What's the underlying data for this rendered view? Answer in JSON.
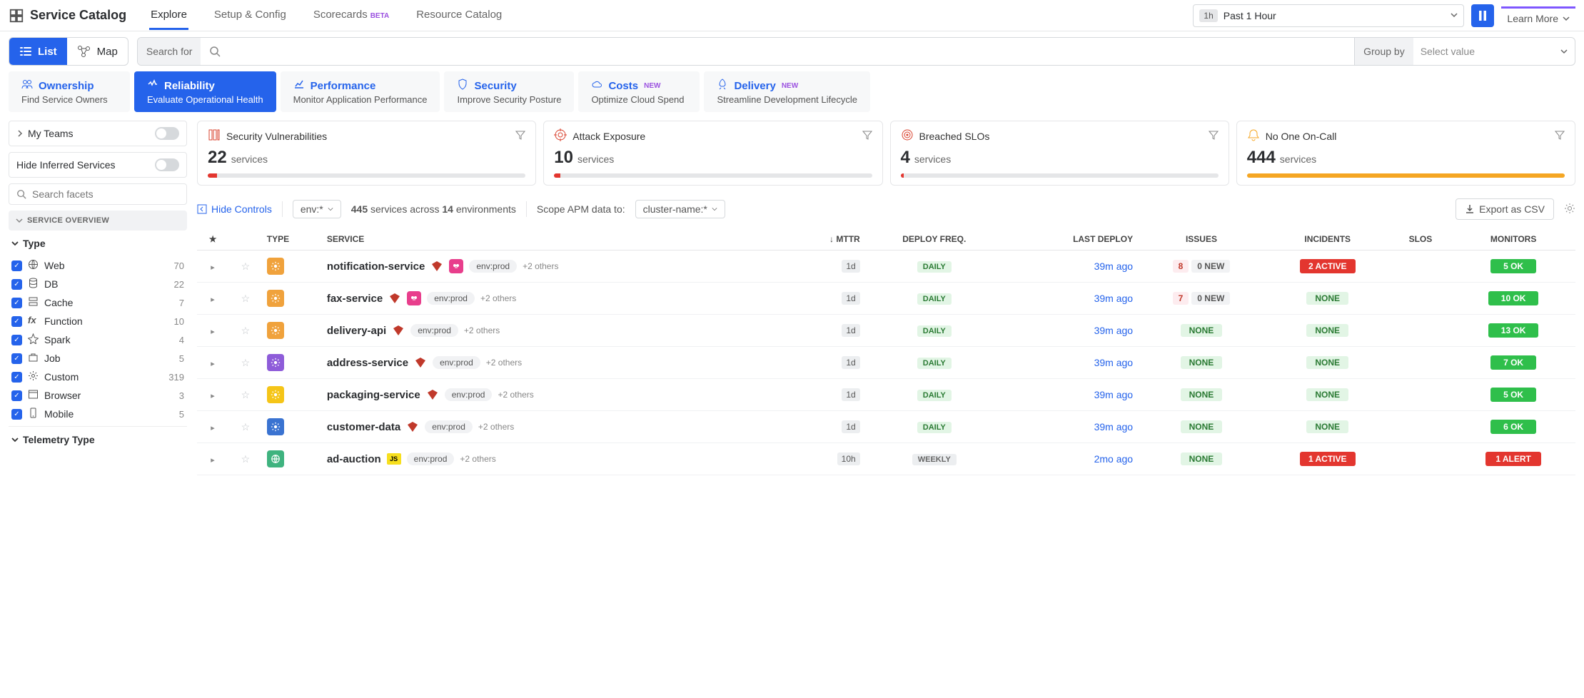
{
  "brand": "Service Catalog",
  "topnav": [
    "Explore",
    "Setup & Config",
    "Scorecards",
    "Resource Catalog"
  ],
  "topnav_beta_idx": 2,
  "timeframe": {
    "badge": "1h",
    "label": "Past 1 Hour"
  },
  "learn_more": "Learn More",
  "view": {
    "list": "List",
    "map": "Map"
  },
  "search": {
    "label": "Search for",
    "placeholder": ""
  },
  "groupby": {
    "label": "Group by",
    "placeholder": "Select value"
  },
  "lenses": [
    {
      "icon": "users",
      "title": "Ownership",
      "sub": "Find Service Owners"
    },
    {
      "icon": "heart",
      "title": "Reliability",
      "sub": "Evaluate Operational Health"
    },
    {
      "icon": "chart",
      "title": "Performance",
      "sub": "Monitor Application Performance"
    },
    {
      "icon": "shield",
      "title": "Security",
      "sub": "Improve Security Posture"
    },
    {
      "icon": "cloud",
      "title": "Costs",
      "sub": "Optimize Cloud Spend",
      "badge": "NEW"
    },
    {
      "icon": "rocket",
      "title": "Delivery",
      "sub": "Streamline Development Lifecycle",
      "badge": "NEW"
    }
  ],
  "active_lens": 1,
  "side": {
    "my_teams": "My Teams",
    "hide_inferred": "Hide Inferred Services",
    "search_facets": "Search facets",
    "overview": "SERVICE OVERVIEW",
    "type_title": "Type",
    "types": [
      {
        "icon": "globe",
        "label": "Web",
        "count": 70
      },
      {
        "icon": "db",
        "label": "DB",
        "count": 22
      },
      {
        "icon": "cache",
        "label": "Cache",
        "count": 7
      },
      {
        "icon": "fx",
        "label": "Function",
        "count": 10
      },
      {
        "icon": "spark",
        "label": "Spark",
        "count": 4
      },
      {
        "icon": "job",
        "label": "Job",
        "count": 5
      },
      {
        "icon": "gear",
        "label": "Custom",
        "count": 319
      },
      {
        "icon": "browser",
        "label": "Browser",
        "count": 3
      },
      {
        "icon": "mobile",
        "label": "Mobile",
        "count": 5
      }
    ],
    "telemetry_title": "Telemetry Type"
  },
  "cards": [
    {
      "icon": "vuln",
      "color": "#d9432f",
      "title": "Security Vulnerabilities",
      "n": 22,
      "u": "services",
      "fill": 3,
      "fillColor": "#e3362f"
    },
    {
      "icon": "target",
      "color": "#d9432f",
      "title": "Attack Exposure",
      "n": 10,
      "u": "services",
      "fill": 2,
      "fillColor": "#e3362f"
    },
    {
      "icon": "slo",
      "color": "#d9432f",
      "title": "Breached SLOs",
      "n": 4,
      "u": "services",
      "fill": 1,
      "fillColor": "#e3362f"
    },
    {
      "icon": "bell",
      "color": "#f5a623",
      "title": "No One On-Call",
      "n": 444,
      "u": "services",
      "fill": 100,
      "fillColor": "#f5a623"
    }
  ],
  "controls": {
    "hide": "Hide Controls",
    "env": "env:*",
    "count_n": "445",
    "count_txt": " services across ",
    "env_n": "14",
    "env_txt": " environments",
    "scope": "Scope APM data to:",
    "cluster": "cluster-name:*",
    "csv": "Export as CSV"
  },
  "columns": [
    "",
    "",
    "TYPE",
    "SERVICE",
    "MTTR",
    "DEPLOY FREQ.",
    "LAST DEPLOY",
    "ISSUES",
    "INCIDENTS",
    "SLOS",
    "MONITORS"
  ],
  "rows": [
    {
      "type": "custom",
      "typeColor": "#f0a23c",
      "name": "notification-service",
      "ruby": true,
      "watch": true,
      "env": "env:prod",
      "others": "+2 others",
      "mttr": "1d",
      "freq": "DAILY",
      "deploy": "39m ago",
      "issues_n": 8,
      "issues_new": "0 NEW",
      "incidents": "2 ACTIVE",
      "incidents_style": "active",
      "monitors": "5 OK",
      "monitors_style": "ok"
    },
    {
      "type": "custom",
      "typeColor": "#f0a23c",
      "name": "fax-service",
      "ruby": true,
      "watch": true,
      "env": "env:prod",
      "others": "+2 others",
      "mttr": "1d",
      "freq": "DAILY",
      "deploy": "39m ago",
      "issues_n": 7,
      "issues_new": "0 NEW",
      "incidents": "NONE",
      "incidents_style": "none",
      "monitors": "10 OK",
      "monitors_style": "ok"
    },
    {
      "type": "custom",
      "typeColor": "#f0a23c",
      "name": "delivery-api",
      "ruby": true,
      "env": "env:prod",
      "others": "+2 others",
      "mttr": "1d",
      "freq": "DAILY",
      "deploy": "39m ago",
      "issues": "NONE",
      "incidents": "NONE",
      "incidents_style": "none",
      "monitors": "13 OK",
      "monitors_style": "ok"
    },
    {
      "type": "custom",
      "typeColor": "#8e5cd9",
      "name": "address-service",
      "ruby": true,
      "env": "env:prod",
      "others": "+2 others",
      "mttr": "1d",
      "freq": "DAILY",
      "deploy": "39m ago",
      "issues": "NONE",
      "incidents": "NONE",
      "incidents_style": "none",
      "monitors": "7 OK",
      "monitors_style": "ok"
    },
    {
      "type": "custom",
      "typeColor": "#f5c518",
      "name": "packaging-service",
      "ruby": true,
      "env": "env:prod",
      "others": "+2 others",
      "mttr": "1d",
      "freq": "DAILY",
      "deploy": "39m ago",
      "issues": "NONE",
      "incidents": "NONE",
      "incidents_style": "none",
      "monitors": "5 OK",
      "monitors_style": "ok"
    },
    {
      "type": "custom",
      "typeColor": "#3a73d1",
      "name": "customer-data",
      "ruby": true,
      "env": "env:prod",
      "others": "+2 others",
      "mttr": "1d",
      "freq": "DAILY",
      "deploy": "39m ago",
      "issues": "NONE",
      "incidents": "NONE",
      "incidents_style": "none",
      "monitors": "6 OK",
      "monitors_style": "ok"
    },
    {
      "type": "web",
      "typeColor": "#3fb37f",
      "name": "ad-auction",
      "js": true,
      "env": "env:prod",
      "others": "+2 others",
      "mttr": "10h",
      "freq": "WEEKLY",
      "deploy": "2mo ago",
      "issues": "NONE",
      "incidents": "1 ACTIVE",
      "incidents_style": "active",
      "monitors": "1 ALERT",
      "monitors_style": "alert"
    }
  ]
}
